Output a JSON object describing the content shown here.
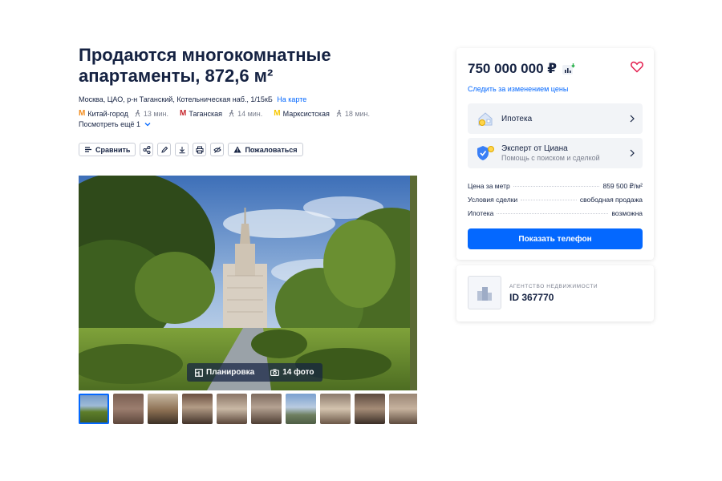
{
  "listing": {
    "title": "Продаются многокомнатные апартаменты, 872,6 м²",
    "address": "Москва, ЦАО, р-н Таганский, Котельническая наб., 1/15кБ",
    "map_link": "На карте",
    "metro": [
      {
        "name": "Китай-город",
        "time": "13 мин.",
        "color": "#f28c1e"
      },
      {
        "name": "Таганская",
        "time": "14 мин.",
        "color": "#c6272d"
      },
      {
        "name": "Марксистская",
        "time": "18 мин.",
        "color": "#f7c700"
      }
    ],
    "more_label": "Посмотреть ещё 1"
  },
  "toolbar": {
    "compare_label": "Сравнить",
    "report_label": "Пожаловаться",
    "icons": [
      "share-icon",
      "edit-icon",
      "download-icon",
      "print-icon",
      "hide-icon"
    ]
  },
  "gallery": {
    "plan_label": "Планировка",
    "photos_label": "14 фото",
    "thumbs_count": 10
  },
  "offer": {
    "price": "750 000 000 ₽",
    "track_label": "Следить за изменением цены",
    "mortgage_label": "Ипотека",
    "expert_title": "Эксперт от Циана",
    "expert_sub": "Помощь с поиском и сделкой",
    "facts": [
      {
        "k": "Цена за метр",
        "v": "859 500 ₽/м²"
      },
      {
        "k": "Условия сделки",
        "v": "свободная продажа"
      },
      {
        "k": "Ипотека",
        "v": "возможна"
      }
    ],
    "phone_label": "Показать телефон"
  },
  "agency": {
    "type": "АГЕНТСТВО НЕДВИЖИМОСТИ",
    "id": "ID 367770"
  },
  "colors": {
    "accent": "#0468ff",
    "text": "#152242",
    "heart": "#e31c4d"
  }
}
